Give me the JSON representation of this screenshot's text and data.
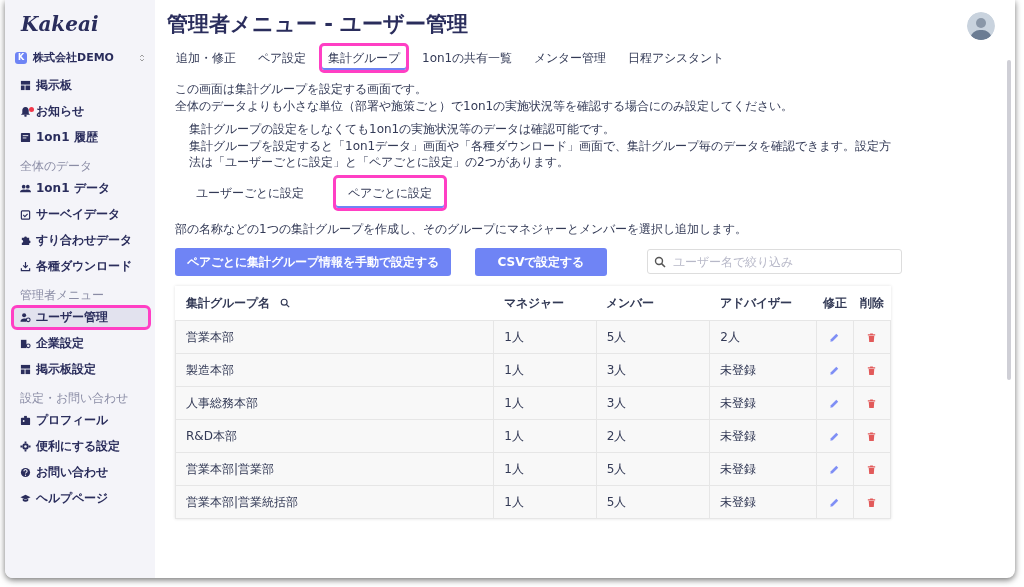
{
  "logo": "Kakeai",
  "company": {
    "initial": "K",
    "name": "株式会社DEMO"
  },
  "sidebar": [
    {
      "kind": "item",
      "label": "掲示板",
      "selected": false,
      "highlighted": false,
      "notification": false
    },
    {
      "kind": "item",
      "label": "お知らせ",
      "selected": false,
      "highlighted": false,
      "notification": true
    },
    {
      "kind": "item",
      "label": "1on1 履歴",
      "selected": false,
      "highlighted": false,
      "notification": false
    },
    {
      "kind": "section",
      "label": "全体のデータ"
    },
    {
      "kind": "item",
      "label": "1on1 データ",
      "selected": false,
      "highlighted": false,
      "notification": false
    },
    {
      "kind": "item",
      "label": "サーベイデータ",
      "selected": false,
      "highlighted": false,
      "notification": false
    },
    {
      "kind": "item",
      "label": "すり合わせデータ",
      "selected": false,
      "highlighted": false,
      "notification": false
    },
    {
      "kind": "item",
      "label": "各種ダウンロード",
      "selected": false,
      "highlighted": false,
      "notification": false
    },
    {
      "kind": "section",
      "label": "管理者メニュー"
    },
    {
      "kind": "item",
      "label": "ユーザー管理",
      "selected": true,
      "highlighted": true,
      "notification": false
    },
    {
      "kind": "item",
      "label": "企業設定",
      "selected": false,
      "highlighted": false,
      "notification": false
    },
    {
      "kind": "item",
      "label": "掲示板設定",
      "selected": false,
      "highlighted": false,
      "notification": false
    },
    {
      "kind": "section",
      "label": "設定・お問い合わせ"
    },
    {
      "kind": "item",
      "label": "プロフィール",
      "selected": false,
      "highlighted": false,
      "notification": false
    },
    {
      "kind": "item",
      "label": "便利にする設定",
      "selected": false,
      "highlighted": false,
      "notification": false
    },
    {
      "kind": "item",
      "label": "お問い合わせ",
      "selected": false,
      "highlighted": false,
      "notification": false
    },
    {
      "kind": "item",
      "label": "ヘルプページ",
      "selected": false,
      "highlighted": false,
      "notification": false
    }
  ],
  "title": "管理者メニュー - ユーザー管理",
  "tabs": [
    {
      "label": "追加・修正",
      "selected": false,
      "highlighted": false
    },
    {
      "label": "ペア設定",
      "selected": false,
      "highlighted": false
    },
    {
      "label": "集計グループ",
      "selected": true,
      "highlighted": true
    },
    {
      "label": "1on1の共有一覧",
      "selected": false,
      "highlighted": false
    },
    {
      "label": "メンター管理",
      "selected": false,
      "highlighted": false
    },
    {
      "label": "日程アシスタント",
      "selected": false,
      "highlighted": false
    }
  ],
  "intro": [
    "この画面は集計グループを設定する画面です。",
    "全体のデータよりも小さな単位（部署や施策ごと）で1on1の実施状況等を確認する場合にのみ設定してください。"
  ],
  "notes": [
    "集計グループの設定をしなくても1on1の実施状況等のデータは確認可能です。",
    "集計グループを設定すると「1on1データ」画面や「各種ダウンロード」画面で、集計グループ毎のデータを確認できます。設定方法は「ユーザーごとに設定」と「ペアごとに設定」の2つがあります。"
  ],
  "subtabs": [
    {
      "label": "ユーザーごとに設定",
      "selected": false,
      "highlighted": false
    },
    {
      "label": "ペアごとに設定",
      "selected": true,
      "highlighted": true
    }
  ],
  "description": "部の名称などの1つの集計グループを作成し、そのグループにマネジャーとメンバーを選択し追加します。",
  "buttons": [
    "ペアごとに集計グループ情報を手動で設定する",
    "CSVで設定する"
  ],
  "search": {
    "placeholder": "ユーザー名で絞り込み"
  },
  "table": {
    "columns": [
      "集計グループ名",
      "マネジャー",
      "メンバー",
      "アドバイザー",
      "修正",
      "削除"
    ],
    "rows": [
      [
        "営業本部",
        "1人",
        "5人",
        "2人"
      ],
      [
        "製造本部",
        "1人",
        "3人",
        "未登録"
      ],
      [
        "人事総務本部",
        "1人",
        "3人",
        "未登録"
      ],
      [
        "R&D本部",
        "1人",
        "2人",
        "未登録"
      ],
      [
        "営業本部|営業部",
        "1人",
        "5人",
        "未登録"
      ],
      [
        "営業本部|営業統括部",
        "1人",
        "5人",
        "未登録"
      ]
    ]
  }
}
